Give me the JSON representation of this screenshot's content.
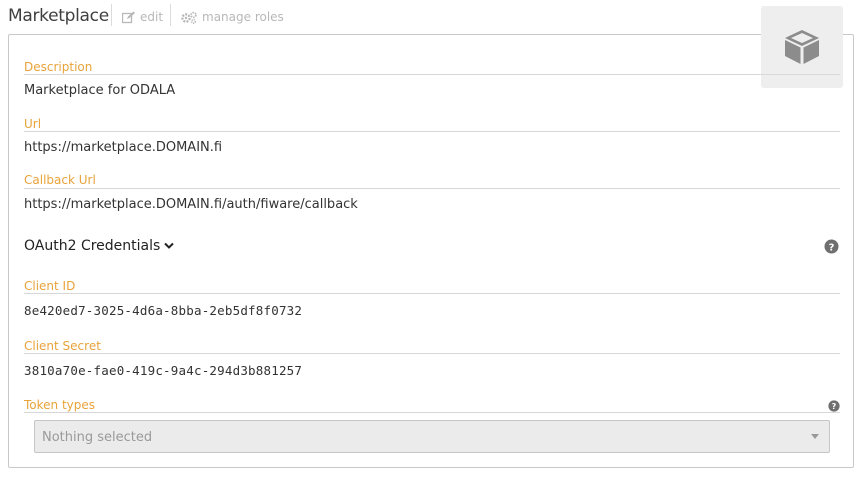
{
  "header": {
    "title": "Marketplace",
    "edit_label": "edit",
    "manage_roles_label": "manage roles"
  },
  "fields": {
    "description": {
      "label": "Description",
      "value": "Marketplace for ODALA"
    },
    "url": {
      "label": "Url",
      "value": "https://marketplace.DOMAIN.fi"
    },
    "callback_url": {
      "label": "Callback Url",
      "value": "https://marketplace.DOMAIN.fi/auth/fiware/callback"
    }
  },
  "oauth": {
    "section_title": "OAuth2 Credentials",
    "client_id": {
      "label": "Client ID",
      "value": "8e420ed7-3025-4d6a-8bba-2eb5df8f0732"
    },
    "client_secret": {
      "label": "Client Secret",
      "value": "3810a70e-fae0-419c-9a4c-294d3b881257"
    },
    "token_types": {
      "label": "Token types",
      "placeholder": "Nothing selected"
    }
  },
  "icons": {
    "app": "cube-icon",
    "edit": "edit-icon",
    "manage_roles": "gears-icon",
    "help": "question-circle-icon",
    "expand": "chevron-down-icon"
  },
  "colors": {
    "label": "#e8a33a",
    "muted": "#b8b8b8",
    "icon_box": "#eeeeee"
  }
}
